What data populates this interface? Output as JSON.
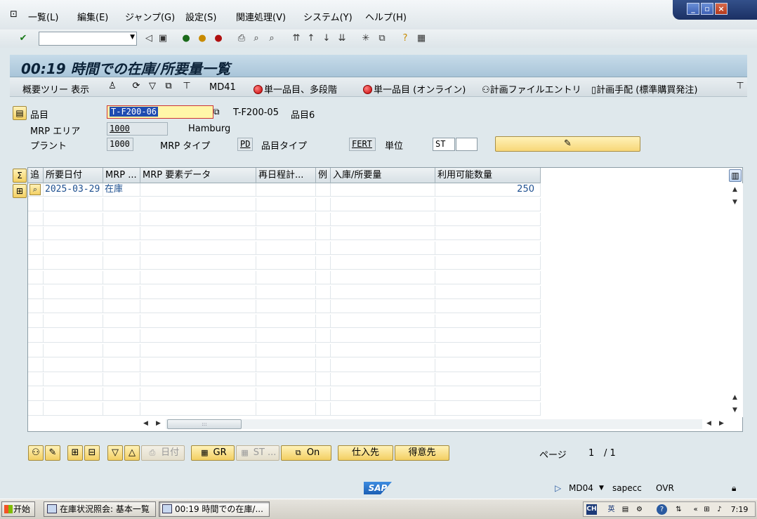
{
  "menu": {
    "items": [
      "一覧(L)",
      "編集(E)",
      "ジャンプ(G)",
      "設定(S)",
      "関連処理(V)",
      "システム(Y)",
      "ヘルプ(H)"
    ]
  },
  "window": {
    "minimize": "_",
    "restore": "▫",
    "close": "×"
  },
  "standard_toolbar": {
    "command_field_value": ""
  },
  "title": "00:19 時間での在庫/所要量一覧",
  "app_toolbar": {
    "overview_tree": "概要ツリー 表示",
    "md41": "MD41",
    "single_item_multilevel": "単一品目、多段階",
    "single_item_online": "単一品目 (オンライン)",
    "planning_file_entry": "計画ファイルエントリ",
    "planning_manual": "計画手配 (標準購買発注)"
  },
  "header": {
    "material_label": "品目",
    "material_value": "T-F200-06",
    "material_ref_value": "T-F200-05",
    "material_desc": "品目6",
    "mrp_area_label": "MRP エリア",
    "mrp_area_value": "1000",
    "mrp_area_name": "Hamburg",
    "plant_label": "プラント",
    "plant_value": "1000",
    "mrp_type_label": "MRP タイプ",
    "mrp_type_value": "PD",
    "material_type_label": "品目タイプ",
    "material_type_value": "FERT",
    "unit_label": "単位",
    "unit_value": "ST",
    "unit_extra_value": ""
  },
  "table": {
    "columns": [
      "追",
      "所要日付",
      "MRP ...",
      "MRP 要素データ",
      "再日程計...",
      "例",
      "入庫/所要量",
      "利用可能数量"
    ],
    "rows": [
      {
        "date": "2025-03-29",
        "mrp_element": "在庫",
        "element_data": "",
        "reschedule": "",
        "exception": "",
        "receipt_req": "",
        "available": "250"
      }
    ]
  },
  "bottom_buttons": {
    "date_label": "日付",
    "gr_label": "GR",
    "st_label": "ST ...",
    "on_label": "On",
    "vendor_label": "仕入先",
    "customer_label": "得意先",
    "page_label": "ページ",
    "page_current": "1",
    "page_total": "/ 1"
  },
  "status_bar": {
    "logo": "SAP",
    "transaction": "MD04",
    "server": "sapecc",
    "mode": "OVR"
  },
  "taskbar": {
    "start": "开始",
    "task1": "在庫状況照会: 基本一覧",
    "task2": "00:19 時間での在庫/...",
    "lang": "CH",
    "ime": "英",
    "clock": "7:19"
  }
}
